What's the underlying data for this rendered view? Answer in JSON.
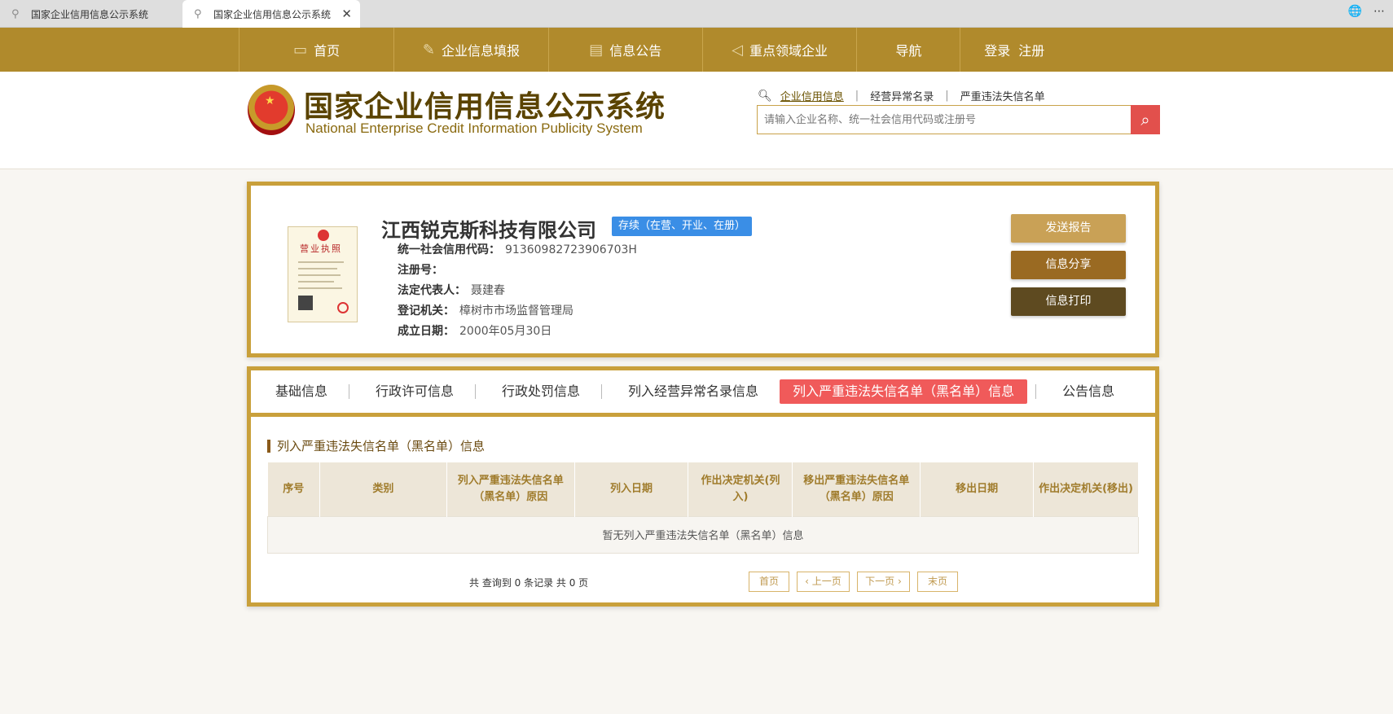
{
  "browser": {
    "tabs": [
      {
        "title": "国家企业信用信息公示系统"
      },
      {
        "title": "国家企业信用信息公示系统"
      }
    ],
    "close_glyph": "✕",
    "globe_glyph": "🌐",
    "more_glyph": "⋯"
  },
  "nav": {
    "items": [
      "首页",
      "企业信息填报",
      "信息公告",
      "重点领域企业",
      "导航"
    ],
    "login": "登录",
    "register": "注册"
  },
  "header": {
    "title_cn": "国家企业信用信息公示系统",
    "title_en": "National Enterprise Credit Information Publicity System",
    "search_links": [
      "企业信用信息",
      "经营异常名录",
      "严重违法失信名单"
    ],
    "search_placeholder": "请输入企业名称、统一社会信用代码或注册号"
  },
  "company": {
    "name": "江西锐克斯科技有限公司",
    "status": "存续（在营、开业、在册）",
    "license_label": "营业执照",
    "fields": [
      {
        "label": "统一社会信用代码：",
        "value": "91360982723906703H"
      },
      {
        "label": "注册号：",
        "value": ""
      },
      {
        "label": "法定代表人：",
        "value": "聂建春"
      },
      {
        "label": "登记机关：",
        "value": "樟树市市场监督管理局"
      },
      {
        "label": "成立日期：",
        "value": "2000年05月30日"
      }
    ],
    "actions": [
      "发送报告",
      "信息分享",
      "信息打印"
    ]
  },
  "detail": {
    "tabs": [
      "基础信息",
      "行政许可信息",
      "行政处罚信息",
      "列入经营异常名录信息",
      "列入严重违法失信名单（黑名单）信息",
      "公告信息"
    ],
    "active_tab": 4,
    "section_title": "列入严重违法失信名单（黑名单）信息",
    "columns": [
      "序号",
      "类别",
      "列入严重违法失信名单（黑名单）原因",
      "列入日期",
      "作出决定机关(列入)",
      "移出严重违法失信名单（黑名单）原因",
      "移出日期",
      "作出决定机关(移出)"
    ],
    "empty_text": "暂无列入严重违法失信名单（黑名单）信息",
    "pager_info": "共 查询到 0 条记录 共 0 页",
    "pager": {
      "first": "首页",
      "prev": "上一页",
      "next": "下一页",
      "last": "末页"
    }
  },
  "colors": {
    "nav_bg": "#b08a2c",
    "border_gold": "#c9a03b",
    "active_tab": "#f05a5a",
    "status_blue": "#3a8ee6",
    "search_btn": "#e2504c"
  }
}
